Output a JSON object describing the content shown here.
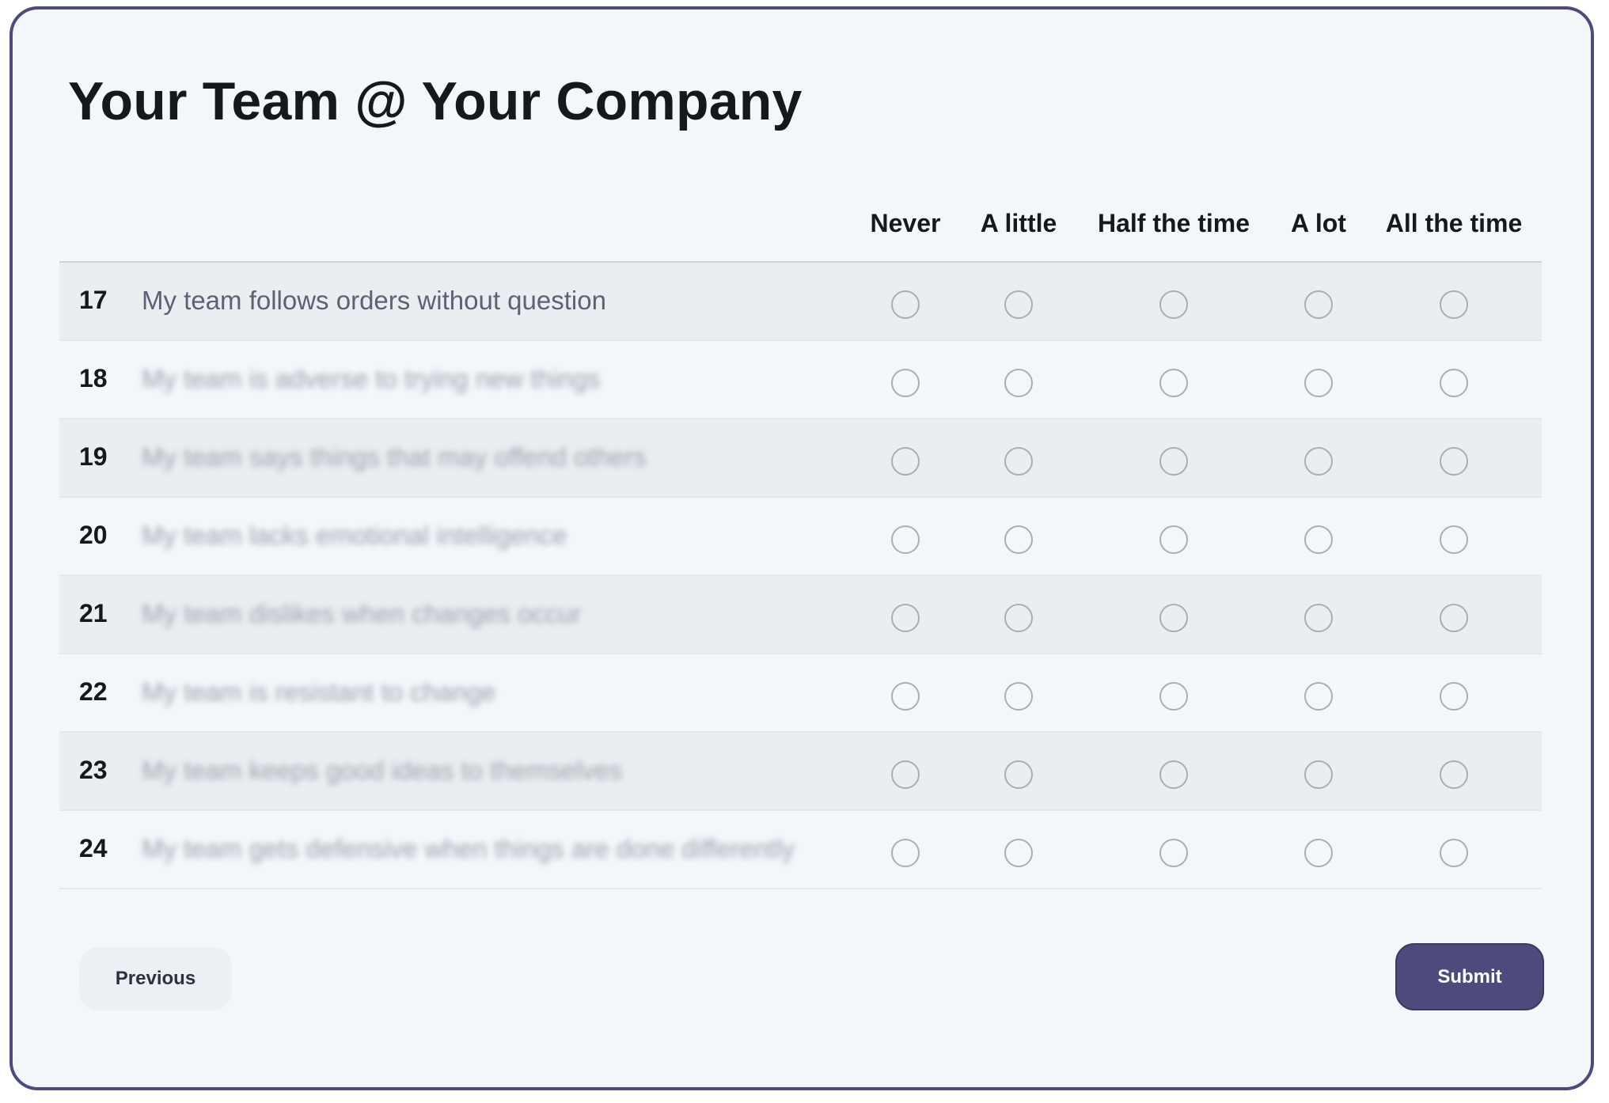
{
  "page": {
    "title": "Your Team @ Your Company"
  },
  "scale": {
    "columns": [
      "Never",
      "A little",
      "Half the time",
      "A lot",
      "All the time"
    ]
  },
  "questions": [
    {
      "number": "17",
      "text": "My team follows orders without question",
      "obscured": false,
      "selected": null
    },
    {
      "number": "18",
      "text": "My team is adverse to trying new things",
      "obscured": true,
      "selected": null
    },
    {
      "number": "19",
      "text": "My team says things that may offend others",
      "obscured": true,
      "selected": null
    },
    {
      "number": "20",
      "text": "My team lacks emotional intelligence",
      "obscured": true,
      "selected": null
    },
    {
      "number": "21",
      "text": "My team dislikes when changes occur",
      "obscured": true,
      "selected": null
    },
    {
      "number": "22",
      "text": "My team is resistant to change",
      "obscured": true,
      "selected": null
    },
    {
      "number": "23",
      "text": "My team keeps good ideas to themselves",
      "obscured": true,
      "selected": null
    },
    {
      "number": "24",
      "text": "My team gets defensive when things are done differently",
      "obscured": true,
      "selected": null
    }
  ],
  "buttons": {
    "previous": "Previous",
    "submit": "Submit"
  },
  "colors": {
    "accent": "#4d4a7c",
    "row_shade": "#ebeef1",
    "background": "#f4f7fa"
  }
}
